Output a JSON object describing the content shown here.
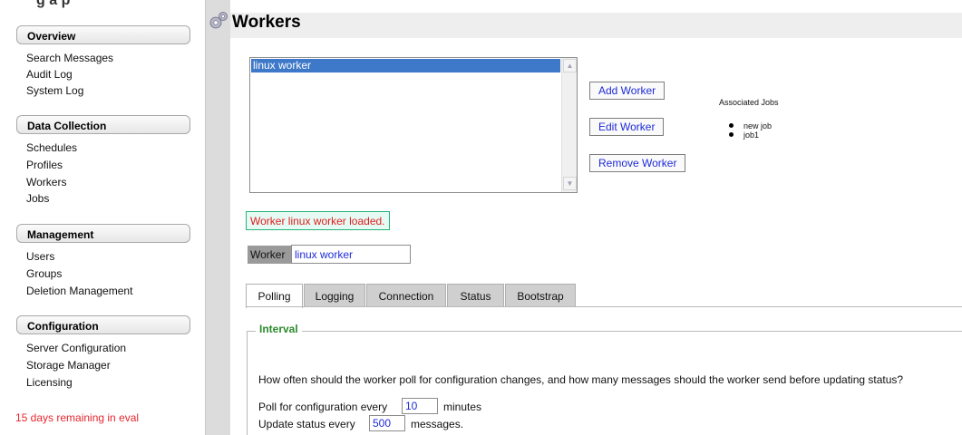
{
  "header": {
    "cropped_text": "g a p"
  },
  "sidebar": {
    "sections": [
      {
        "title": "Overview",
        "items": [
          "Search Messages",
          "Audit Log",
          "System Log"
        ]
      },
      {
        "title": "Data Collection",
        "items": [
          "Schedules",
          "Profiles",
          "Workers",
          "Jobs"
        ]
      },
      {
        "title": "Management",
        "items": [
          "Users",
          "Groups",
          "Deletion Management"
        ]
      },
      {
        "title": "Configuration",
        "items": [
          "Server Configuration",
          "Storage Manager",
          "Licensing"
        ]
      }
    ],
    "eval_note": "15 days remaining in eval"
  },
  "page": {
    "title": "Workers",
    "title_icon": "gears-icon"
  },
  "workers_list": {
    "items": [
      "linux worker"
    ],
    "selected": "linux worker"
  },
  "buttons": {
    "add": "Add Worker",
    "edit": "Edit Worker",
    "remove": "Remove Worker"
  },
  "associated_jobs": {
    "title": "Associated Jobs",
    "items": [
      "new job",
      "job1"
    ]
  },
  "status_message": "Worker linux worker loaded.",
  "worker_field": {
    "label": "Worker",
    "value": "linux worker"
  },
  "tabs": [
    "Polling",
    "Logging",
    "Connection",
    "Status",
    "Bootstrap"
  ],
  "active_tab": "Polling",
  "interval": {
    "legend": "Interval",
    "question": "How often should the worker poll for configuration changes, and how many messages should the worker send before updating status?",
    "poll_prefix": "Poll for configuration every",
    "poll_value": "10",
    "poll_suffix": "minutes",
    "status_prefix": "Update status every",
    "status_value": "500",
    "status_suffix": "messages."
  },
  "colors": {
    "selection": "#3e78c8",
    "link_blue": "#1e2bd8",
    "legend_green": "#2b8a2b",
    "alert_red": "#e01d1d",
    "eval_red": "#e8262e"
  }
}
